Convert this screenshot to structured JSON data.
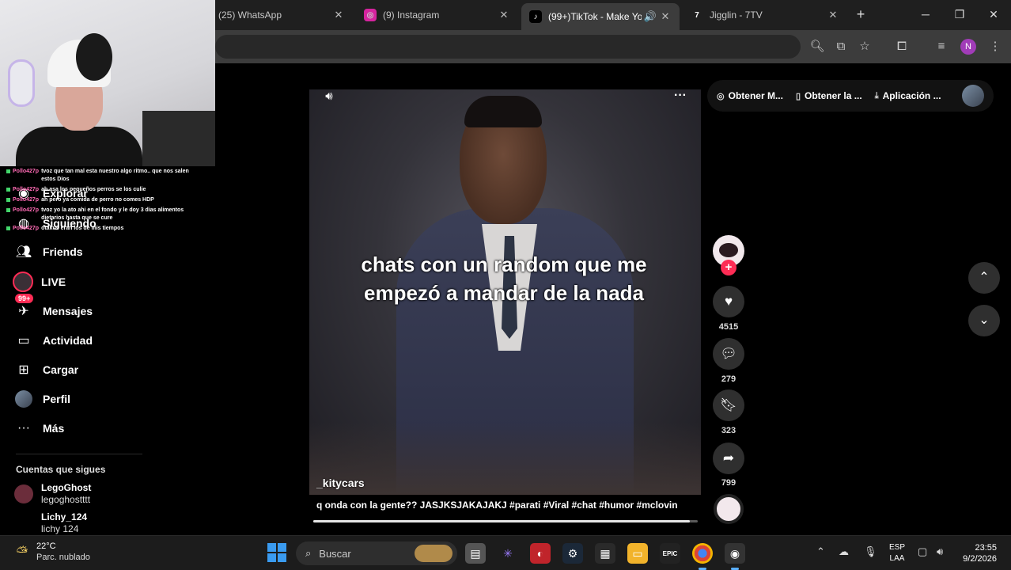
{
  "browser": {
    "tabs": [
      {
        "title": "(25) WhatsApp",
        "icon": "whatsapp-icon"
      },
      {
        "title": "(9) Instagram",
        "icon": "instagram-icon"
      },
      {
        "title": "(99+)TikTok - Make Your",
        "icon": "tiktok-icon",
        "active": true
      },
      {
        "title": "Jigglin - 7TV",
        "icon": "7tv-icon"
      }
    ],
    "new_tab": "+",
    "profile_initial": "N"
  },
  "stream_chat": [
    {
      "user": "Pollo427p",
      "text": "tvoz que tan mal esta nuestro algo ritmo.. que nos salen estos Dios"
    },
    {
      "user": "Pollo427p",
      "text": "ah asa los pequeños perros se los culie"
    },
    {
      "user": "Pollo427p",
      "text": "ah pero ya comida de perro no comes HDP"
    },
    {
      "user": "Pollo427p",
      "text": "tvoz yo la ato ahi en el fondo y le doy 3 dias alimentos dietarios hasta que se cure"
    },
    {
      "user": "Pollo427p",
      "text": "otakus eran los de mis tiempos"
    }
  ],
  "sidebar": {
    "items": [
      {
        "label": "Explorar",
        "icon": "compass-icon"
      },
      {
        "label": "Siguiendo",
        "icon": "following-icon"
      },
      {
        "label": "Friends",
        "icon": "friends-icon"
      },
      {
        "label": "LIVE",
        "icon": "live-icon"
      },
      {
        "label": "Mensajes",
        "icon": "messages-icon",
        "badge": "99+"
      },
      {
        "label": "Actividad",
        "icon": "activity-icon"
      },
      {
        "label": "Cargar",
        "icon": "upload-icon"
      },
      {
        "label": "Perfil",
        "icon": "profile-icon"
      },
      {
        "label": "Más",
        "icon": "more-icon"
      }
    ],
    "following_title": "Cuentas que sigues",
    "accounts": [
      {
        "name": "LegoGhost",
        "handle": "legoghostttt"
      },
      {
        "name": "Lichy_124",
        "handle": "lichy 124"
      }
    ]
  },
  "topbar": {
    "items": [
      {
        "label": "Obtener M...",
        "icon": "coin-icon"
      },
      {
        "label": "Obtener la ...",
        "icon": "phone-icon"
      },
      {
        "label": "Aplicación ...",
        "icon": "download-icon"
      }
    ]
  },
  "video": {
    "caption_overlay": "chats con un random que me empezó a mandar de la nada",
    "author": "_kitycars",
    "description": "q onda con la gente?? JASJKSJAKAJAKJ #parati #Viral #chat #humor #mclovin",
    "progress": 0.98
  },
  "actions": {
    "likes": "4515",
    "comments": "279",
    "saves": "323",
    "shares": "799"
  },
  "taskbar": {
    "weather_temp": "22°C",
    "weather_desc": "Parc. nublado",
    "search_placeholder": "Buscar",
    "lang_top": "ESP",
    "lang_bottom": "LAA",
    "time": "23:55",
    "date": "9/2/2026"
  },
  "colors": {
    "accent": "#fe2c55",
    "background": "#000000",
    "chat_user": "#ff6bb5"
  }
}
